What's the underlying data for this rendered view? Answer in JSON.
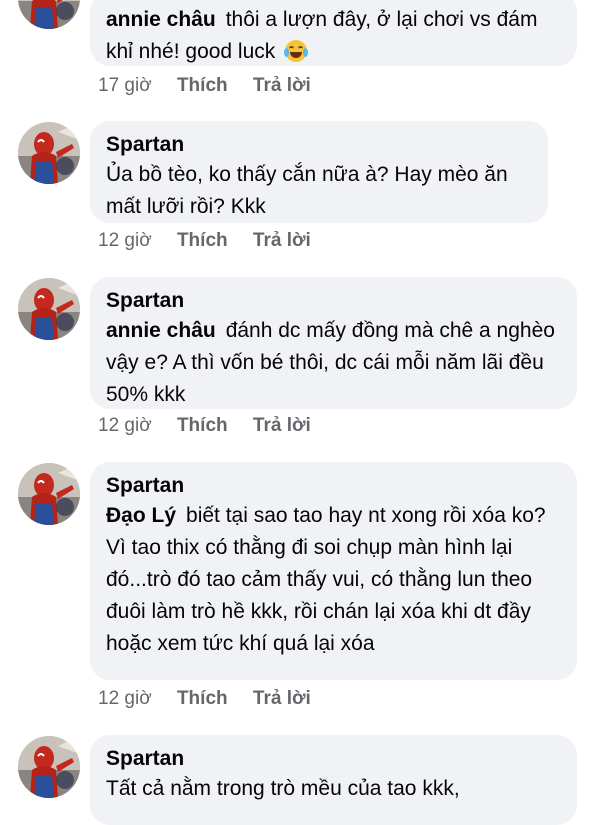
{
  "comments": [
    {
      "author": "",
      "mention": "annie châu",
      "text": "thôi a lượn đây, ở lại chơi vs đám khỉ nhé! good luck",
      "emoji": "face-with-tears-of-joy",
      "time": "17 giờ",
      "like": "Thích",
      "reply": "Trả lời"
    },
    {
      "author": "Spartan",
      "mention": "",
      "text": "Ủa bồ tèo, ko thấy cắn nữa à? Hay mèo ăn mất lưỡi rồi? Kkk",
      "time": "12 giờ",
      "like": "Thích",
      "reply": "Trả lời"
    },
    {
      "author": "Spartan",
      "mention": "annie châu",
      "text": "đánh dc mấy đồng mà chê a nghèo vậy e? A thì vốn bé thôi, dc cái mỗi năm lãi đều 50% kkk",
      "time": "12 giờ",
      "like": "Thích",
      "reply": "Trả lời"
    },
    {
      "author": "Spartan",
      "mention": "Đạo Lý",
      "text": "biết tại sao tao hay nt xong rồi xóa ko? Vì tao thix có thằng đi soi chụp màn hình lại đó...trò đó tao cảm thấy vui, có thằng lun theo đuôi làm trò hề kkk, rồi chán lại xóa khi dt đầy hoặc xem tức khí quá lại xóa",
      "time": "12 giờ",
      "like": "Thích",
      "reply": "Trả lời"
    },
    {
      "author": "Spartan",
      "mention": "",
      "text": "Tất cả nằm trong trò mều của tao kkk,"
    }
  ]
}
